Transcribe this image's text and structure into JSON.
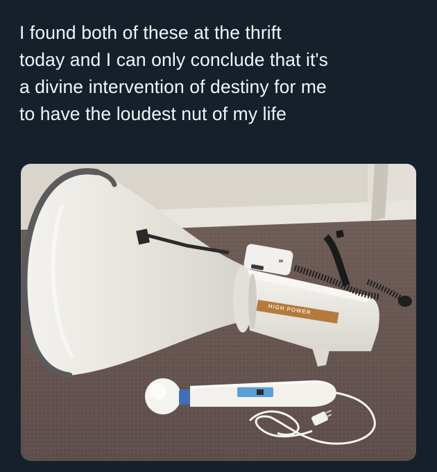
{
  "post": {
    "text": "I found both of these at the thrift\ntoday and I can only conclude that it's\na divine intervention of destiny for me\nto have the loudest nut of my life"
  },
  "photo": {
    "megaphone_label": "HIGH POWER"
  },
  "colors": {
    "background": "#15202b",
    "text": "#f2f4f6",
    "carpet": "#6b5a56",
    "wall": "#d9d4cc",
    "megaphone": "#ecebe4"
  }
}
